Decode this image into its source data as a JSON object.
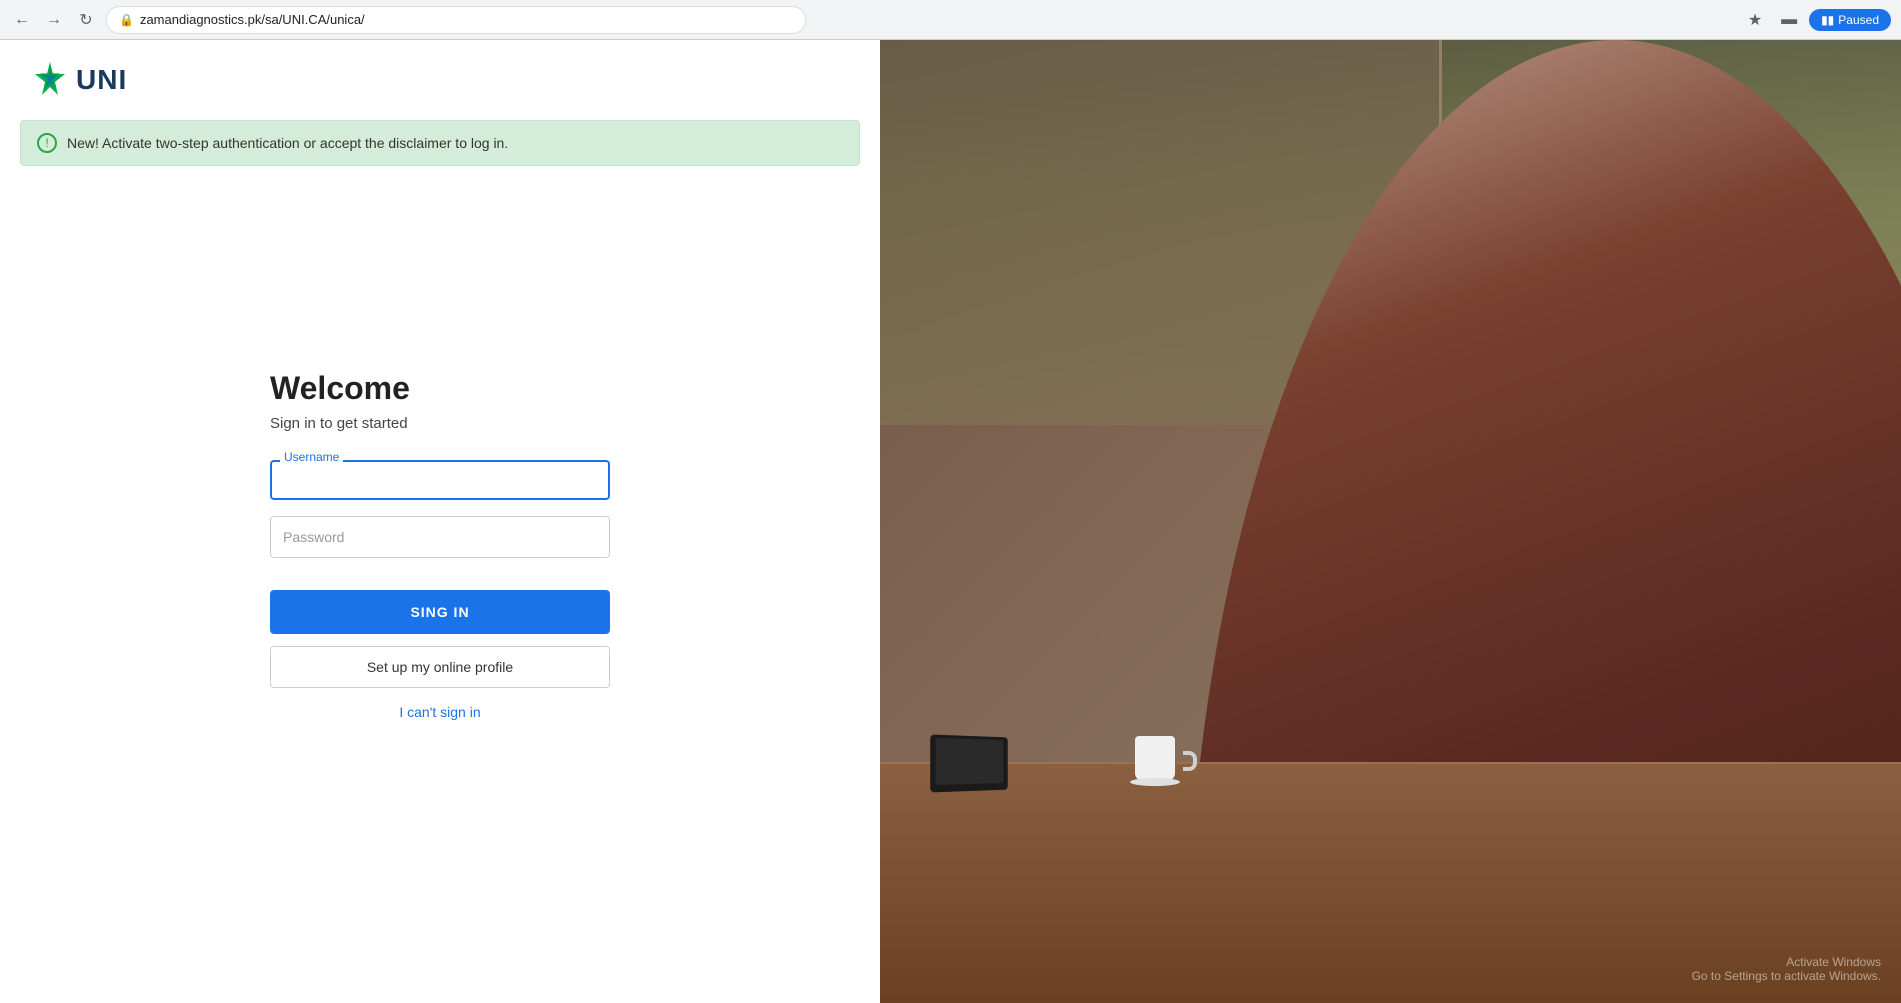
{
  "browser": {
    "url": "zamandiagnostics.pk/sa/UNI.CA/unica/",
    "back_disabled": false,
    "paused_label": "Paused"
  },
  "logo": {
    "text": "UNI"
  },
  "banner": {
    "message": "New! Activate two-step authentication or accept the disclaimer to log in."
  },
  "form": {
    "title": "Welcome",
    "subtitle": "Sign in to get started",
    "username_label": "Username",
    "username_placeholder": "",
    "password_placeholder": "Password",
    "signin_button": "SING IN",
    "setup_profile_button": "Set up my online profile",
    "cant_signin_link": "I can't sign in"
  },
  "activate_windows": {
    "line1": "Activate Windows",
    "line2": "Go to Settings to activate Windows."
  }
}
